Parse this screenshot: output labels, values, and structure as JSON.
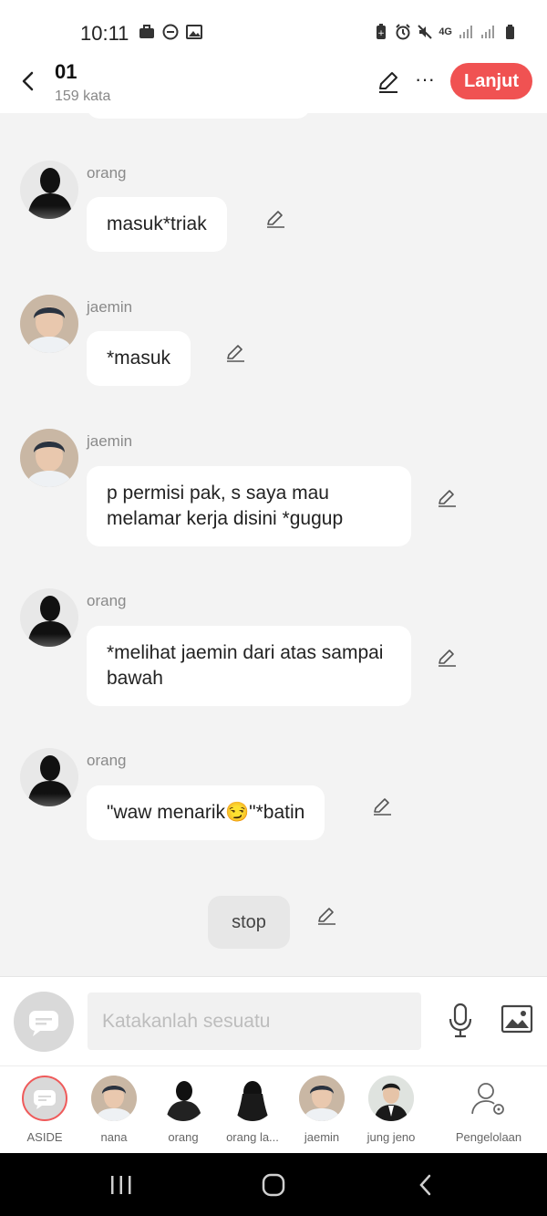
{
  "status_bar": {
    "time": "10:11",
    "network": "4G"
  },
  "header": {
    "title": "01",
    "word_count": "159 kata",
    "next_label": "Lanjut"
  },
  "messages": [
    {
      "sender": "orang",
      "text": "masuk*triak",
      "avatar": "silhouette"
    },
    {
      "sender": "jaemin",
      "text": "*masuk",
      "avatar": "photo"
    },
    {
      "sender": "jaemin",
      "text": "p permisi pak, s saya mau melamar kerja disini *gugup",
      "avatar": "photo"
    },
    {
      "sender": "orang",
      "text": "*melihat jaemin dari atas sampai bawah",
      "avatar": "silhouette"
    },
    {
      "sender": "orang",
      "text": "\"waw menarik😏\"*batin",
      "avatar": "silhouette"
    }
  ],
  "narration": {
    "text": "stop"
  },
  "composer": {
    "placeholder": "Katakanlah sesuatu",
    "mic_icon": "microphone-icon",
    "image_icon": "image-icon"
  },
  "characters": [
    {
      "label": "ASIDE",
      "icon": "chat-bubble-icon"
    },
    {
      "label": "nana",
      "icon": "photo-avatar"
    },
    {
      "label": "orang",
      "icon": "silhouette-avatar"
    },
    {
      "label": "orang la...",
      "icon": "silhouette-long-hair-avatar"
    },
    {
      "label": "jaemin",
      "icon": "photo-avatar"
    },
    {
      "label": "jung jeno",
      "icon": "photo-avatar-suit"
    },
    {
      "label": "Pengelolaan",
      "icon": "user-settings-icon"
    }
  ],
  "colors": {
    "accent": "#f05252",
    "background": "#f3f3f3",
    "bubble": "#ffffff"
  }
}
